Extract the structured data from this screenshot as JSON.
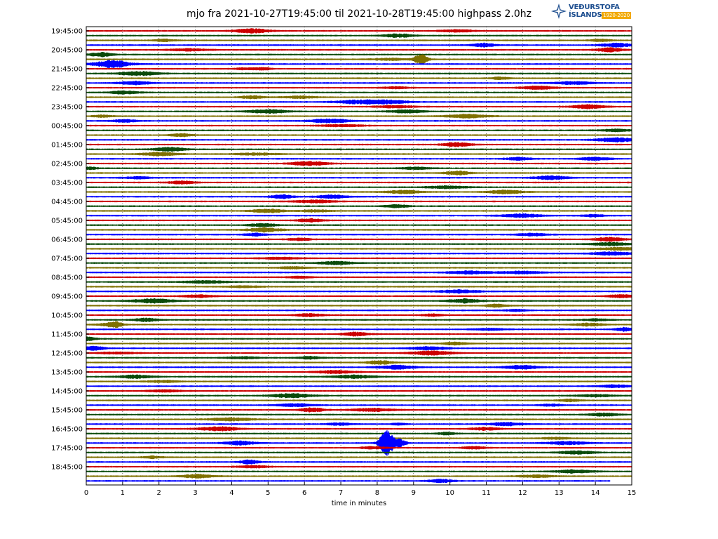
{
  "logo": {
    "word1": "VEÐURSTOFA",
    "word2": "ÍSLANDS",
    "years": "1920-2020"
  },
  "chart_data": {
    "type": "line",
    "title": "mjo fra 2021-10-27T19:45:00 til 2021-10-28T19:45:00 highpass 2.0hz",
    "xlabel": "time in minutes",
    "ylabel": "",
    "xlim": [
      0,
      15
    ],
    "xticks": [
      0,
      1,
      2,
      3,
      4,
      5,
      6,
      7,
      8,
      9,
      10,
      11,
      12,
      13,
      14,
      15
    ],
    "yticks": [
      "19:45:00",
      "20:45:00",
      "21:45:00",
      "22:45:00",
      "23:45:00",
      "00:45:00",
      "01:45:00",
      "02:45:00",
      "03:45:00",
      "04:45:00",
      "05:45:00",
      "06:45:00",
      "07:45:00",
      "08:45:00",
      "09:45:00",
      "10:45:00",
      "11:45:00",
      "12:45:00",
      "13:45:00",
      "14:45:00",
      "15:45:00",
      "16:45:00",
      "17:45:00",
      "18:45:00"
    ],
    "grid": "dotted vertical at each minute",
    "trace_count": 96,
    "colors": [
      "#cc0000",
      "#0a4a0a",
      "#7f7000",
      "#0000ff"
    ],
    "notable_events": [
      {
        "trace": 6,
        "minute": 9.2,
        "amplitude": 3.2
      },
      {
        "trace": 8,
        "minute": 4.9,
        "amplitude": 0.8
      },
      {
        "trace": 87,
        "minute": 8.25,
        "amplitude": 8.5
      },
      {
        "trace": 87,
        "minute": 8.6,
        "amplitude": 2.5
      },
      {
        "trace": 62,
        "minute": 0.82,
        "amplitude": 1.2
      },
      {
        "trace": 83,
        "minute": 8.6,
        "amplitude": 0.7
      }
    ]
  }
}
